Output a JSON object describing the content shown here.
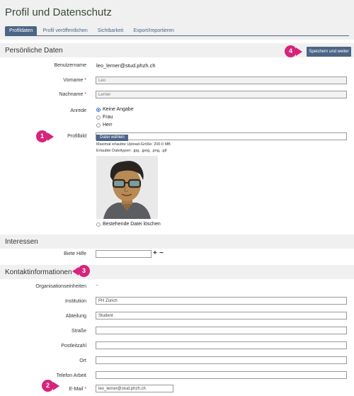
{
  "page": {
    "title": "Profil und Datenschutz"
  },
  "tabs": [
    {
      "label": "Profildaten",
      "active": true
    },
    {
      "label": "Profil veröffentlichen",
      "active": false
    },
    {
      "label": "Sichtbarkeit",
      "active": false
    },
    {
      "label": "Export/Importieren",
      "active": false
    }
  ],
  "actions": {
    "save_label": "Speichern und weiter"
  },
  "personal": {
    "section_title": "Persönliche Daten",
    "username_label": "Benutzername",
    "username_value": "leo_lerner@stud.phzh.ch",
    "firstname_label": "Vorname",
    "firstname_value": "Leo",
    "lastname_label": "Nachname",
    "lastname_value": "Lerner",
    "required_mark": "*",
    "salutation_label": "Anrede",
    "salutation_options": [
      {
        "label": "Keine Angabe",
        "checked": true
      },
      {
        "label": "Frau",
        "checked": false
      },
      {
        "label": "Herr",
        "checked": false
      }
    ],
    "picture_label": "Profilbild",
    "file_button_label": "Datei wählen",
    "max_size_note": "Maximal erlaubte Upload-Größe: 200.0 MB",
    "file_types_note": "Erlaubte Dateitypen: .jpg, .jpeg, .png, .gif",
    "delete_file_label": "Bestehende Datei löschen"
  },
  "interests": {
    "section_title": "Interessen",
    "help_label": "Biete Hilfe",
    "help_value": "",
    "add_symbol": "+",
    "remove_symbol": "−"
  },
  "contact": {
    "section_title": "Kontaktinformationen",
    "org_label": "Organisationseinheiten",
    "org_value": "-",
    "institution_label": "Institution",
    "institution_value": "PH Zürich",
    "department_label": "Abteilung",
    "department_value": "Student",
    "street_label": "Straße",
    "street_value": "",
    "zip_label": "Postleitzahl",
    "zip_value": "",
    "city_label": "Ort",
    "city_value": "",
    "phone_label": "Telefon Arbeit",
    "phone_value": "",
    "email_label": "E-Mail",
    "email_value": "leo_lerner@stud.phzh.ch"
  },
  "annotations": {
    "b1": "1",
    "b2": "2",
    "b3": "3",
    "b4": "4"
  },
  "colors": {
    "accent": "#4c6586",
    "badge": "#d6247b",
    "title": "#38493c",
    "required": "#cc3333"
  }
}
